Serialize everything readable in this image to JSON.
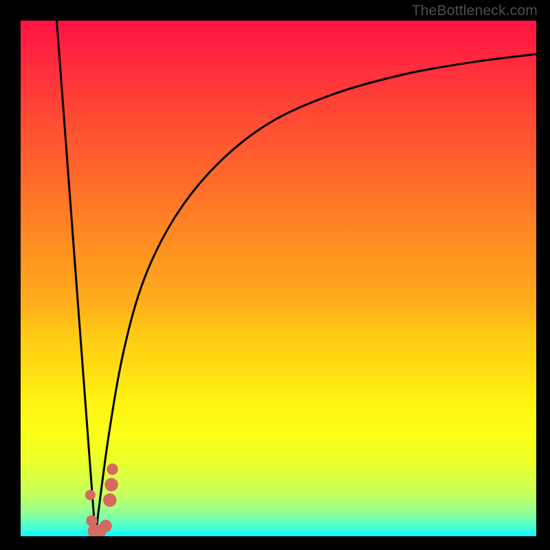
{
  "watermark": "TheBottleneck.com",
  "chart_data": {
    "type": "line",
    "title": "",
    "xlabel": "",
    "ylabel": "",
    "xlim": [
      0,
      100
    ],
    "ylim": [
      0,
      100
    ],
    "background": "heatmap-gradient-red-to-green",
    "series": [
      {
        "name": "descending-branch",
        "x": [
          7,
          14.5
        ],
        "values": [
          100,
          0
        ]
      },
      {
        "name": "ascending-branch",
        "x": [
          14.5,
          17,
          20,
          24,
          30,
          38,
          48,
          60,
          74,
          88,
          100
        ],
        "values": [
          0,
          19,
          36,
          50,
          62,
          72,
          80,
          85.5,
          89.5,
          92,
          93.5
        ]
      }
    ],
    "markers": [
      {
        "x": 13.5,
        "y": 8,
        "r": 1.0
      },
      {
        "x": 13.8,
        "y": 3,
        "r": 1.1
      },
      {
        "x": 14.3,
        "y": 1,
        "r": 1.3
      },
      {
        "x": 15.3,
        "y": 1,
        "r": 1.3
      },
      {
        "x": 16.5,
        "y": 2,
        "r": 1.2
      },
      {
        "x": 17.3,
        "y": 7,
        "r": 1.3
      },
      {
        "x": 17.6,
        "y": 10,
        "r": 1.3
      },
      {
        "x": 17.8,
        "y": 13,
        "r": 1.1
      }
    ],
    "colors": {
      "curve": "#000000",
      "marker": "#d46a60"
    }
  }
}
